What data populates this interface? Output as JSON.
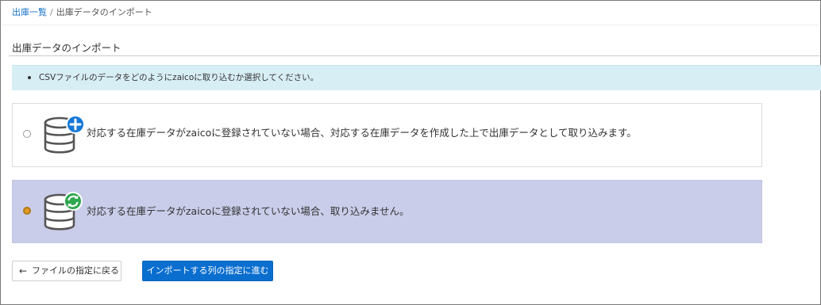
{
  "breadcrumb": {
    "parent": "出庫一覧",
    "separator": "/",
    "current": "出庫データのインポート"
  },
  "page": {
    "title": "出庫データのインポート"
  },
  "info": {
    "message": "CSVファイルのデータをどのようにzaicoに取り込むか選択してください。"
  },
  "options": [
    {
      "label": "対応する在庫データがzaicoに登録されていない場合、対応する在庫データを作成した上で出庫データとして取り込みます。",
      "selected": false,
      "icon": "database-plus-icon"
    },
    {
      "label": "対応する在庫データがzaicoに登録されていない場合、取り込みません。",
      "selected": true,
      "icon": "database-refresh-icon"
    }
  ],
  "buttons": {
    "back_icon": "←",
    "back_label": "ファイルの指定に戻る",
    "next_label": "インポートする列の指定に進む"
  },
  "colors": {
    "link": "#1a73c8",
    "info_bg": "#d8eef5",
    "selected_bg": "#c9cde9",
    "primary_button": "#0a6ecf",
    "plus_badge": "#1677d6",
    "refresh_badge": "#2fa84f"
  }
}
